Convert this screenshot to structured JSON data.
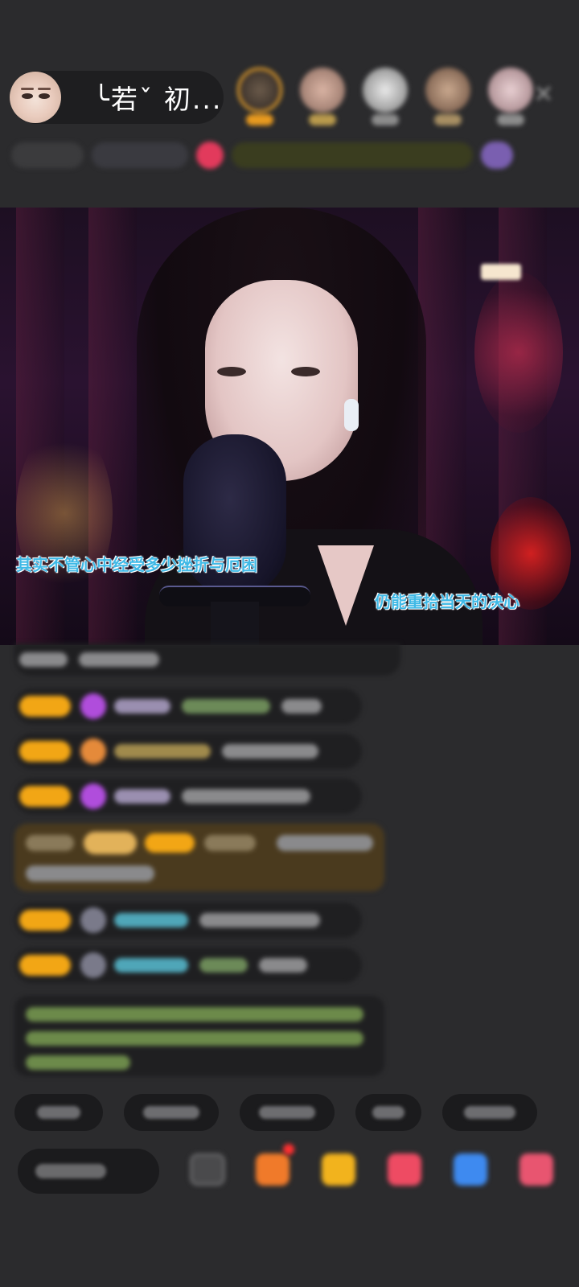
{
  "header": {
    "host_name": "╰若ˇ 初...",
    "close_icon": "close-icon"
  },
  "video": {
    "subtitle_left": "其实不管心中经受多少挫折与厄困",
    "subtitle_right": "仍能重拾当天的决心"
  },
  "colors": {
    "background": "#2b2b2d",
    "level_badge": "#f2a615",
    "subtitle": "#3fb9e6",
    "highlight_row": "#4a3a1e"
  }
}
